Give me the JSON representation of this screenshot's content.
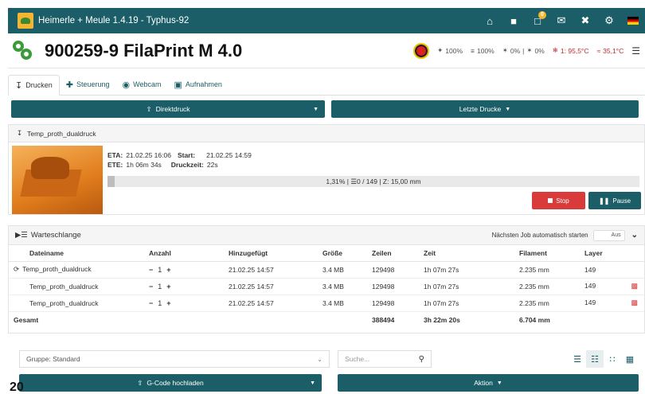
{
  "topbar": {
    "title": "Heimerle + Meule 1.4.19 - Typhus-92",
    "notification_count": "0",
    "icons": [
      "home-icon",
      "sd-card-icon",
      "notification-icon",
      "mail-icon",
      "tools-icon",
      "gear-icon",
      "language-flag-icon"
    ]
  },
  "printer": {
    "name": "900259-9 FilaPrint M 4.0",
    "stats": {
      "fan_speed": "100%",
      "flow": "100%",
      "fan_left": "0%",
      "fan_right": "0%",
      "extruder_temp": "1: 95,5°C",
      "bed_temp": "35,1°C"
    }
  },
  "tabs": [
    {
      "label": "Drucken",
      "icon": "print-icon",
      "active": true
    },
    {
      "label": "Steuerung",
      "icon": "move-icon"
    },
    {
      "label": "Webcam",
      "icon": "webcam-icon"
    },
    {
      "label": "Aufnahmen",
      "icon": "camera-icon"
    }
  ],
  "actions": {
    "direct_print": "Direktdruck",
    "recent_prints": "Letzte Drucke"
  },
  "job": {
    "filename": "Temp_proth_dualdruck",
    "eta_label": "ETA:",
    "eta_value": "21.02.25 16:06",
    "start_label": "Start:",
    "start_value": "21.02.25 14:59",
    "ete_label": "ETE:",
    "ete_value": "1h 06m 34s",
    "print_time_label": "Druckzeit:",
    "print_time_value": "22s",
    "progress_fraction": 0.0131,
    "progress_text": "1,31% | ☰0 / 149 | Z: 15,00 mm",
    "stop_label": "Stop",
    "pause_label": "Pause"
  },
  "queue": {
    "title": "Warteschlange",
    "auto_start_label": "Nächsten Job automatisch starten",
    "toggle_label": "Aus",
    "columns": [
      "Dateiname",
      "Anzahl",
      "Hinzugefügt",
      "Größe",
      "Zeilen",
      "Zeit",
      "Filament",
      "Layer"
    ],
    "rows": [
      {
        "name": "Temp_proth_dualdruck",
        "count": "1",
        "added": "21.02.25 14:57",
        "size": "3.4 MB",
        "lines": "129498",
        "time": "1h 07m 27s",
        "filament": "2.235 mm",
        "layer": "149"
      },
      {
        "name": "Temp_proth_dualdruck",
        "count": "1",
        "added": "21.02.25 14:57",
        "size": "3.4 MB",
        "lines": "129498",
        "time": "1h 07m 27s",
        "filament": "2.235 mm",
        "layer": "149"
      },
      {
        "name": "Temp_proth_dualdruck",
        "count": "1",
        "added": "21.02.25 14:57",
        "size": "3.4 MB",
        "lines": "129498",
        "time": "1h 07m 27s",
        "filament": "2.235 mm",
        "layer": "149"
      }
    ],
    "total_label": "Gesamt",
    "total_lines": "388494",
    "total_time": "3h 22m 20s",
    "total_filament": "6.704 mm"
  },
  "footer": {
    "group_value": "Gruppe: Standard",
    "search_placeholder": "Suche...",
    "upload_label": "G-Code hochladen",
    "action_label": "Aktion"
  },
  "page_number": "20"
}
